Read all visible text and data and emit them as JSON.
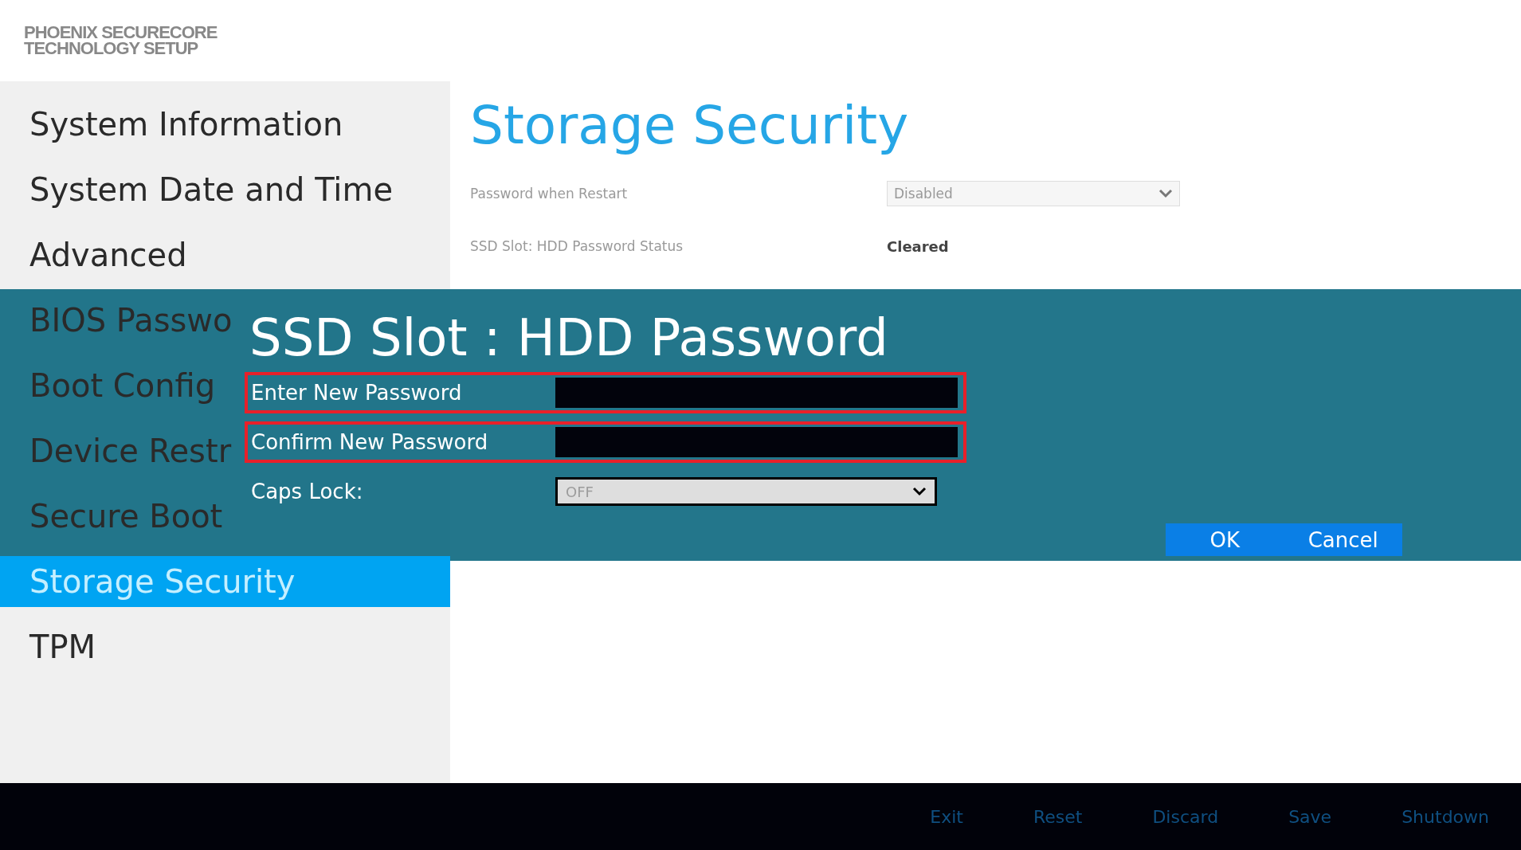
{
  "header": {
    "logo_lines": [
      "PHOENIX SECURECORE",
      "TECHNOLOGY SETUP"
    ]
  },
  "sidebar": {
    "items": [
      {
        "label": "System Information",
        "selected": false
      },
      {
        "label": "System Date and Time",
        "selected": false
      },
      {
        "label": "Advanced",
        "selected": false
      },
      {
        "label": "BIOS Passwo",
        "selected": false
      },
      {
        "label": "Boot Config",
        "selected": false
      },
      {
        "label": "Device Restr",
        "selected": false
      },
      {
        "label": "Secure Boot",
        "selected": false
      },
      {
        "label": "Storage Security",
        "selected": true
      },
      {
        "label": "TPM",
        "selected": false
      }
    ]
  },
  "page": {
    "title": "Storage Security",
    "settings": [
      {
        "kind": "dropdown",
        "label": "Password when Restart",
        "value": "Disabled"
      },
      {
        "kind": "status",
        "label": "SSD Slot: HDD Password Status",
        "value": "Cleared"
      }
    ]
  },
  "dialog": {
    "title": "SSD Slot : HDD Password",
    "fields": [
      {
        "kind": "password",
        "label": "Enter New Password",
        "highlighted": true
      },
      {
        "kind": "password",
        "label": "Confirm New Password",
        "highlighted": true
      },
      {
        "kind": "dropdown",
        "label": "Caps Lock:",
        "value": "OFF",
        "disabled": true
      }
    ],
    "buttons": [
      "OK",
      "Cancel"
    ]
  },
  "footer": {
    "actions": [
      "Exit",
      "Reset",
      "Discard",
      "Save",
      "Shutdown"
    ]
  }
}
